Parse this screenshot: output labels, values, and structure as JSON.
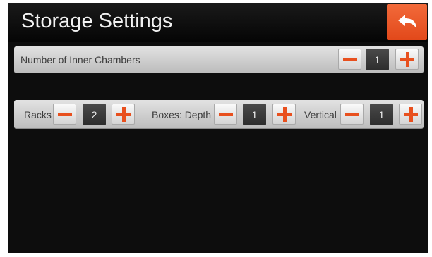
{
  "header": {
    "title": "Storage Settings",
    "back_icon": "return-arrow-icon"
  },
  "colors": {
    "accent": "#e8501e",
    "background": "#0d0d0d",
    "panel": "#d2d2d2"
  },
  "chambers": {
    "label": "Number of Inner Chambers",
    "value": "1"
  },
  "racks_row": {
    "racks": {
      "label": "Racks",
      "value": "2"
    },
    "boxes_depth": {
      "label": "Boxes: Depth",
      "value": "1"
    },
    "vertical": {
      "label": "Vertical",
      "value": "1"
    }
  }
}
